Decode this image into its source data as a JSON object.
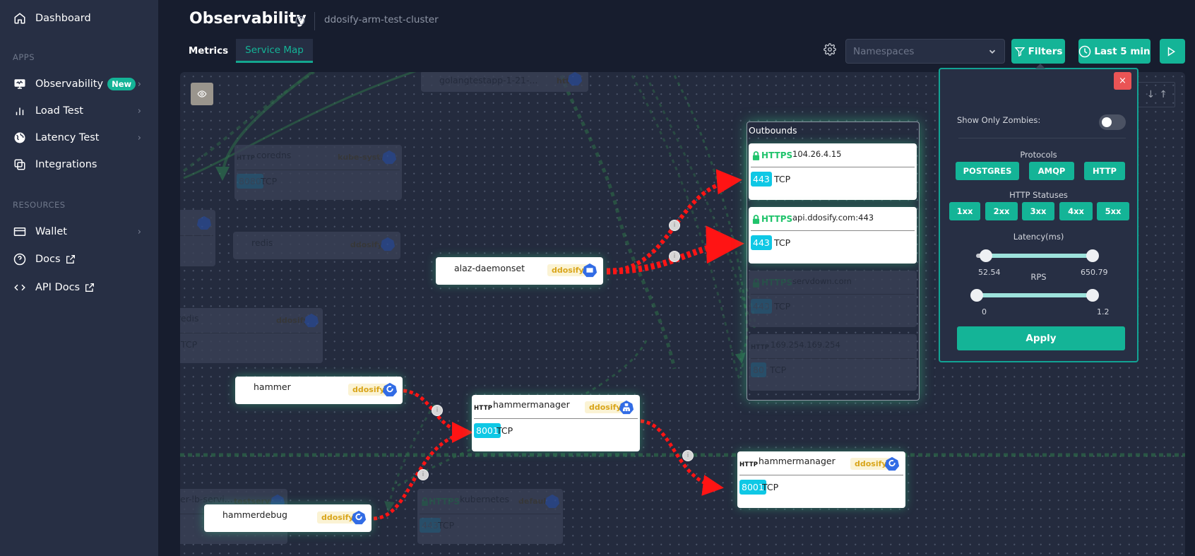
{
  "sidebar": {
    "dashboard": "Dashboard",
    "apps_section": "APPS",
    "items_apps": [
      {
        "label": "Observability",
        "badge": "New",
        "icon": "monitor-icon"
      },
      {
        "label": "Load Test",
        "icon": "bar-chart-icon"
      },
      {
        "label": "Latency Test",
        "icon": "globe-icon"
      },
      {
        "label": "Integrations",
        "icon": "integrations-icon"
      }
    ],
    "resources_section": "RESOURCES",
    "items_resources": [
      {
        "label": "Wallet",
        "icon": "wallet-icon"
      },
      {
        "label": "Docs",
        "icon": "help-circle-icon"
      },
      {
        "label": "API Docs",
        "icon": "code-icon"
      }
    ]
  },
  "header": {
    "title": "Observability",
    "cluster": "ddosify-arm-test-cluster",
    "tabs": [
      {
        "label": "Metrics",
        "active": false
      },
      {
        "label": "Service Map",
        "active": true
      }
    ]
  },
  "toolbar": {
    "namespace_placeholder": "Namespaces",
    "filters_label": "Filters",
    "time_label": "Last 5 min"
  },
  "map": {
    "outbounds_label": "Outbounds",
    "nodes": {
      "alaz": {
        "name": "alaz-daemonset",
        "namespace": "ddosify"
      },
      "hammer": {
        "name": "hammer",
        "namespace": "ddosify"
      },
      "hammerdebug": {
        "name": "hammerdebug",
        "namespace": "ddosify"
      },
      "hammermanager_svc": {
        "name": "hammermanager",
        "namespace": "ddosify",
        "protocol": "HTTP",
        "port": "8001",
        "transport": "TCP"
      },
      "hammermanager_dep": {
        "name": "hammermanager",
        "namespace": "ddosify",
        "protocol": "HTTP",
        "port": "8001",
        "transport": "TCP"
      },
      "coredns": {
        "name": "coredns",
        "namespace": "kube-syst...",
        "protocol": "HTTP",
        "port": "8080",
        "transport": "TCP"
      },
      "redis_dep": {
        "name": "redis",
        "namespace": "ddosify"
      },
      "redis_svc": {
        "name": "redis",
        "namespace": "ddosify",
        "transport": "TCP"
      },
      "golang": {
        "name": "golangtestapp-1-21-...",
        "namespace": "https"
      },
      "lb": {
        "name": "er-lb-servi...",
        "namespace": "testserver"
      },
      "kubernetes": {
        "name": "kubernetes",
        "namespace": "default",
        "protocol": "HTTPS",
        "port": "443",
        "transport": "TCP"
      },
      "partial": {
        "namespace": "t..."
      }
    },
    "outbounds": [
      {
        "protocol": "HTTPS",
        "host": "104.26.4.15",
        "port": "443",
        "transport": "TCP",
        "dim": false
      },
      {
        "protocol": "HTTPS",
        "host": "api.ddosify.com:443",
        "port": "443",
        "transport": "TCP",
        "dim": false
      },
      {
        "protocol": "HTTPS",
        "host": "servdown.com",
        "port": "443",
        "transport": "TCP",
        "dim": true
      },
      {
        "protocol": "HTTP",
        "host": "169.254.169.254",
        "port": "80",
        "transport": "TCP",
        "dim": true
      }
    ]
  },
  "filters": {
    "show_zombies_label": "Show Only Zombies:",
    "show_zombies": false,
    "protocols_title": "Protocols",
    "protocols": [
      "POSTGRES",
      "AMQP",
      "HTTP"
    ],
    "statuses_title": "HTTP Statuses",
    "statuses": [
      "1xx",
      "2xx",
      "3xx",
      "4xx",
      "5xx"
    ],
    "latency_title": "Latency(ms)",
    "latency_min": "52.54",
    "latency_max": "650.79",
    "rps_title": "RPS",
    "rps_min": "0",
    "rps_max": "1.2",
    "apply_label": "Apply",
    "close_label": "×"
  },
  "colors": {
    "accent": "#14b497",
    "edge_error": "#ff1414",
    "edge_ok": "#2d7a4f",
    "port_badge": "#0fc8e5",
    "close": "#ea5455"
  }
}
